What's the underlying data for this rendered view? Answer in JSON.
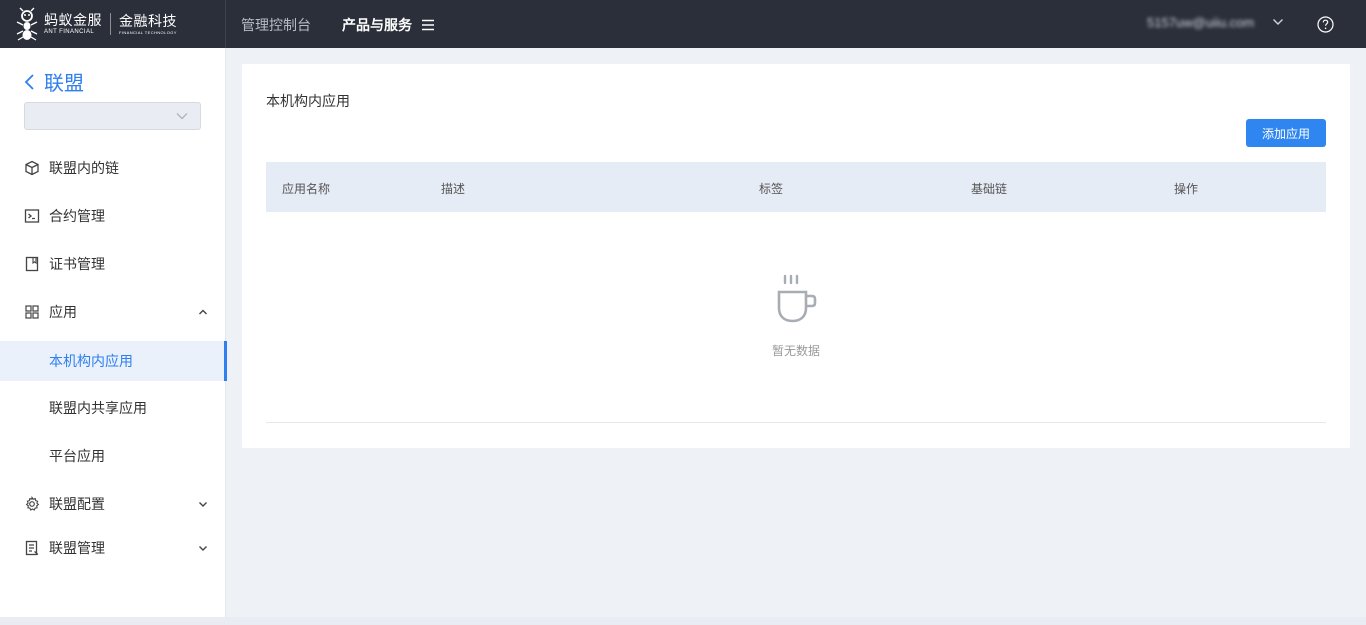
{
  "header": {
    "logo_cn": "蚂蚁金服",
    "logo_en": "ANT FINANCIAL",
    "logo2_cn": "金融科技",
    "logo2_en": "FINANCIAL TECHNOLOGY",
    "nav_console": "管理控制台",
    "nav_products": "产品与服务",
    "user": "5157uw@uiiu.com"
  },
  "sidebar": {
    "back_label": "联盟",
    "select_value": "",
    "items": [
      {
        "label": "联盟内的链",
        "icon": "cube-icon"
      },
      {
        "label": "合约管理",
        "icon": "terminal-icon"
      },
      {
        "label": "证书管理",
        "icon": "bookmark-icon"
      },
      {
        "label": "应用",
        "icon": "grid-icon",
        "expanded": true
      },
      {
        "label": "本机构内应用",
        "active": true
      },
      {
        "label": "联盟内共享应用"
      },
      {
        "label": "平台应用"
      },
      {
        "label": "联盟配置",
        "icon": "gear-icon",
        "expanded": false
      },
      {
        "label": "联盟管理",
        "icon": "doc-list-icon",
        "expanded": false
      }
    ]
  },
  "main": {
    "title": "本机构内应用",
    "add_button": "添加应用",
    "table": {
      "columns": [
        "应用名称",
        "描述",
        "标签",
        "基础链",
        "操作"
      ],
      "rows": []
    },
    "empty_text": "暂无数据"
  },
  "colors": {
    "topbar": "#2b2f3a",
    "accent": "#2f7ff0",
    "page_bg": "#eef1f6",
    "table_header": "#e6ecf5"
  }
}
